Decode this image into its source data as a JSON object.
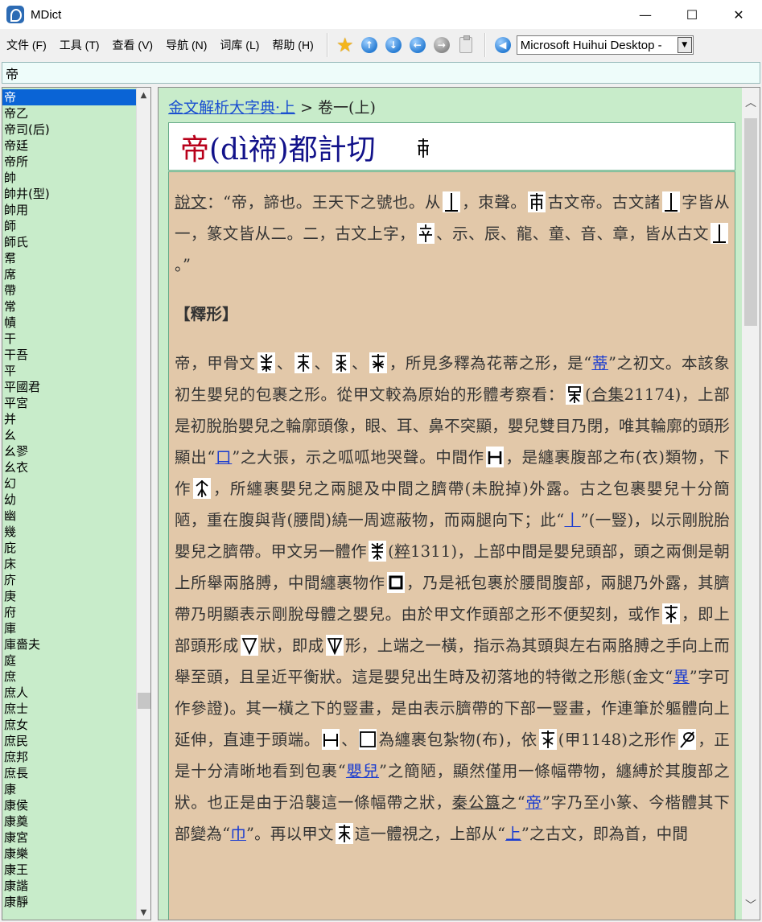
{
  "window": {
    "title": "MDict",
    "controls": [
      "—",
      "☐",
      "✕"
    ]
  },
  "menu": {
    "file": "文件 (F)",
    "tools": "工具 (T)",
    "view": "查看 (V)",
    "nav": "导航 (N)",
    "dict": "词库 (L)",
    "help": "帮助 (H)"
  },
  "toolbar": {
    "dictionary_selected": "Microsoft Huihui Desktop -"
  },
  "search": {
    "value": "帝"
  },
  "wordlist": {
    "items": [
      "帝",
      "帝乙",
      "帝司(后)",
      "帝廷",
      "帝所",
      "帥",
      "帥井(型)",
      "帥用",
      "師",
      "師氏",
      "帬",
      "席",
      "帶",
      "常",
      "幘",
      "干",
      "干吾",
      "平",
      "平國君",
      "平宮",
      "并",
      "幺",
      "幺翏",
      "幺衣",
      "幻",
      "幼",
      "幽",
      "幾",
      "庇",
      "床",
      "庎",
      "庚",
      "府",
      "庫",
      "庫嗇夫",
      "庭",
      "庶",
      "庶人",
      "庶士",
      "庶女",
      "庶民",
      "庶邦",
      "庶長",
      "康",
      "康侯",
      "康奠",
      "康宮",
      "康樂",
      "康王",
      "康諧",
      "康靜"
    ],
    "selected_index": 0
  },
  "entry": {
    "breadcrumb_link": "金文解析大字典·上",
    "breadcrumb_rest": " > 卷一(上)",
    "head_char": "帝",
    "head_pron": "(dì禘)都計切",
    "shuowen_label": "說文",
    "p1a": "：“帝，諦也。王天下之號也。从",
    "p1b": "，朿聲。",
    "p1c": "古文帝。古文諸",
    "p1d": "字皆从一，篆文皆从二。二，古文上字，",
    "p1e": "、示、辰、龍、童、音、章，皆从古文",
    "p1f": "。”",
    "section_title": "【釋形】",
    "p2a": "帝，甲骨文",
    "p2sep": "、",
    "p2b": "，所見多釋為花蒂之形，是“",
    "link_di": "蒂",
    "p2c": "”之初文。本該象初生嬰兒的包裹之形。從甲文較為原始的形體考察看：",
    "p2d": "(",
    "heji": "合集",
    "p2e": "21174)，上部是初脫胎嬰兒之輪廓頭像，眼、耳、鼻不突顯，嬰兒雙目乃閉，唯其輪廓的頭形顯出“",
    "link_kou": "口",
    "p2f": "”之大張，示之呱呱地哭聲。中間作",
    "p2g": "，是纏裹腹部之布(衣)類物，下作",
    "p2h": "，所纏裹嬰兒之兩腿及中間之臍帶(未脫掉)外露。古之包裹嬰兒十分簡陋，重在腹與背(腰間)繞一周遮蔽物，而兩腿向下；此“",
    "link_gun": "丨",
    "p2i": "”(一豎)，以示剛脫胎嬰兒之臍帶。甲文另一體作",
    "p2j": "(",
    "cui": "粹",
    "p2k": "1311)，上部中間是嬰兒頭部，頭之兩側是朝上所舉兩胳膊，中間纏裹物作",
    "p2l": "，乃是衹包裹於腰間腹部，兩腿乃外露，其臍帶乃明顯表示剛脫母體之嬰兒。由於甲文作頭部之形不便契刻，或作",
    "p2m": "，即上部頭形成",
    "p2n": "狀，即成",
    "p2o": "形，上端之一橫，指示為其頭與左右兩胳膊之手向上而舉至頭，且呈近平衡狀。這是嬰兒出生時及初落地的特徵之形態(金文“",
    "link_yi": "異",
    "p2p": "”字可作參證)。其一橫之下的豎畫，是由表示臍帶的下部一豎畫，作連筆於軀體向上延伸，直連于頭端。",
    "p2q": "、",
    "p2r": "為纏裹包紮物(布)，依",
    "p2s": "(",
    "p2s2": "甲1148)之形作",
    "p2t": "，正是十分清晰地看到包裹“",
    "link_yinger": "嬰兒",
    "p2u": "”之簡陋，顯然僅用一條幅帶物，纏縛於其腹部之狀。也正是由于沿襲這一條幅帶之狀，",
    "qin": "秦公簋",
    "p2v": "之“",
    "link_di2": "帝",
    "p2w": "”字乃至小篆、今楷體其下部變為“",
    "link_jin": "巾",
    "p2x": "”。再以甲文",
    "p2y": "這一體視之，上部从“",
    "link_shang": "上",
    "p2z": "”之古文，即為首，中間"
  }
}
